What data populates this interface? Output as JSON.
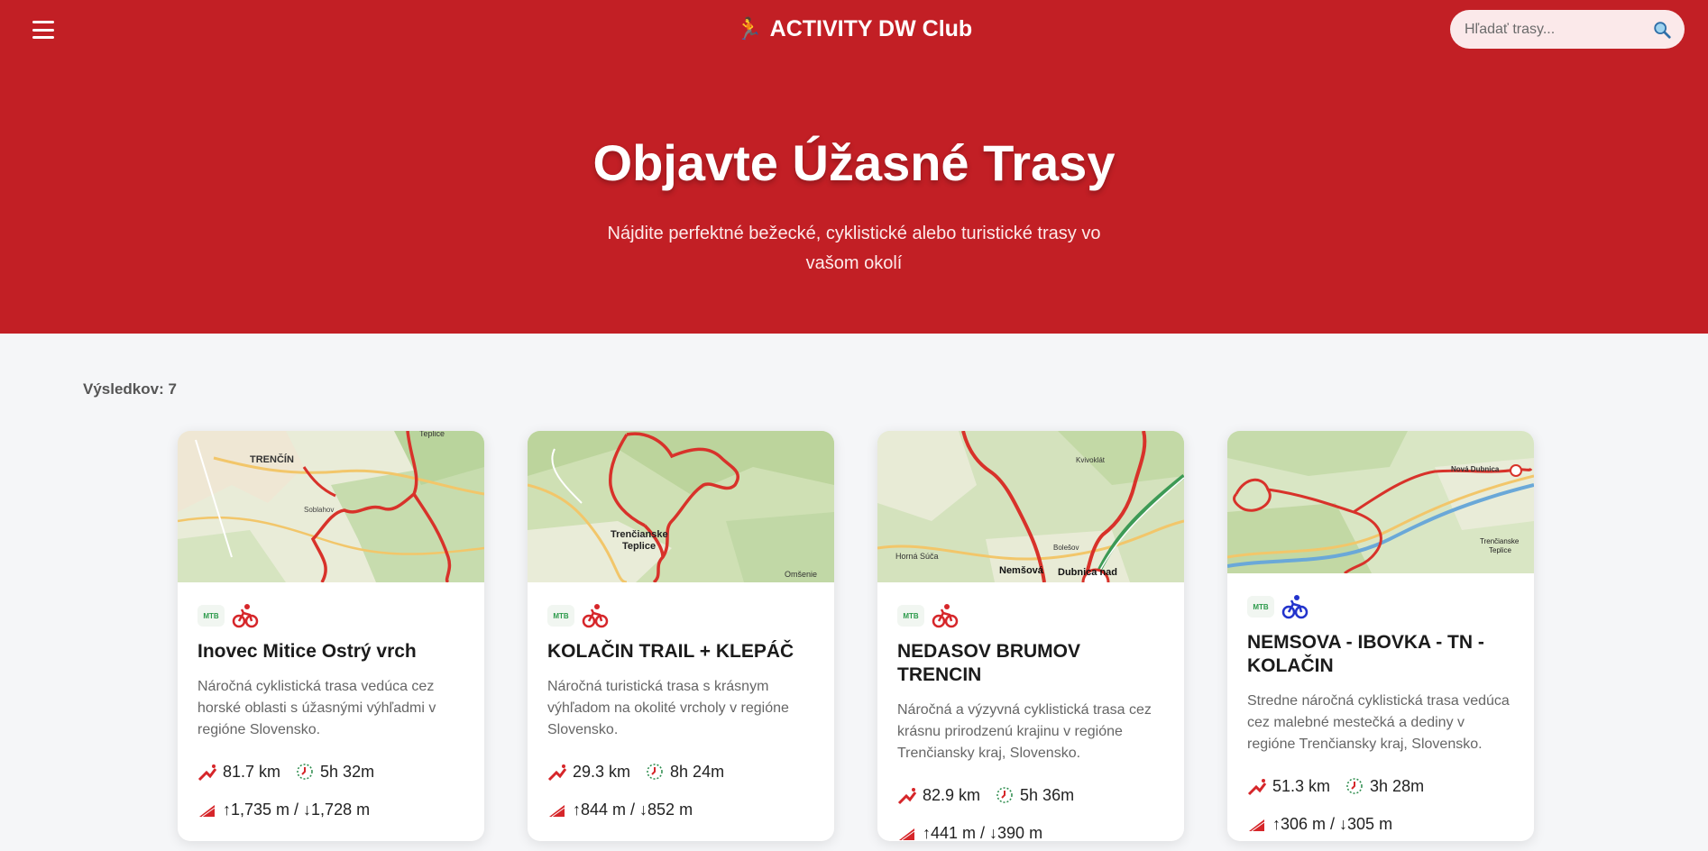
{
  "header": {
    "brand": "ACTIVITY DW Club",
    "search_placeholder": "Hľadať trasy..."
  },
  "hero": {
    "title": "Objavte Úžasné Trasy",
    "subtitle": "Nájdite perfektné bežecké, cyklistické alebo turistické trasy vo vašom okolí"
  },
  "results_label": "Výsledkov: 7",
  "colors": {
    "brand_red": "#c21f25",
    "bike_red": "#d6262a",
    "bike_blue": "#2233cc"
  },
  "cards": [
    {
      "badge": "MTB",
      "bike_icon": "bike-red-icon",
      "title": "Inovec Mitice Ostrý vrch",
      "description": "Náročná cyklistická trasa vedúca cez horské oblasti s úžasnými výhľadmi v regióne Slovensko.",
      "distance": "81.7 km",
      "duration": "5h 32m",
      "elevation": "↑1,735 m / ↓1,728 m",
      "map_labels": [
        "TRENČÍN",
        "Teplice",
        "Soblahov"
      ]
    },
    {
      "badge": "MTB",
      "bike_icon": "bike-red-icon",
      "title": "KOLAČIN TRAIL + KLEPÁČ",
      "description": "Náročná turistická trasa s krásnym výhľadom na okolité vrcholy v regióne Slovensko.",
      "distance": "29.3 km",
      "duration": "8h 24m",
      "elevation": "↑844 m / ↓852 m",
      "map_labels": [
        "Trenčianske",
        "Teplice",
        "Omšenie"
      ]
    },
    {
      "badge": "MTB",
      "bike_icon": "bike-red-icon",
      "title": "NEDASOV BRUMOV TRENCIN",
      "description": "Náročná a výzyvná cyklistická trasa cez krásnu prirodzenú krajinu v regióne Trenčiansky kraj, Slovensko.",
      "distance": "82.9 km",
      "duration": "5h 36m",
      "elevation": "↑441 m / ↓390 m",
      "map_labels": [
        "Nemšová",
        "Dubnica nad",
        "Horná Súča",
        "Kvivoklát",
        "Bolešov"
      ]
    },
    {
      "badge": "MTB",
      "bike_icon": "bike-blue-icon",
      "title": "NEMSOVA - IBOVKA - TN - KOLAČIN",
      "description": "Stredne náročná cyklistická trasa vedúca cez malebné mestečká a dediny v regióne Trenčiansky kraj, Slovensko.",
      "distance": "51.3 km",
      "duration": "3h 28m",
      "elevation": "↑306 m / ↓305 m",
      "map_labels": [
        "Nová Dubnica",
        "Trenčianske",
        "Teplice"
      ]
    }
  ]
}
